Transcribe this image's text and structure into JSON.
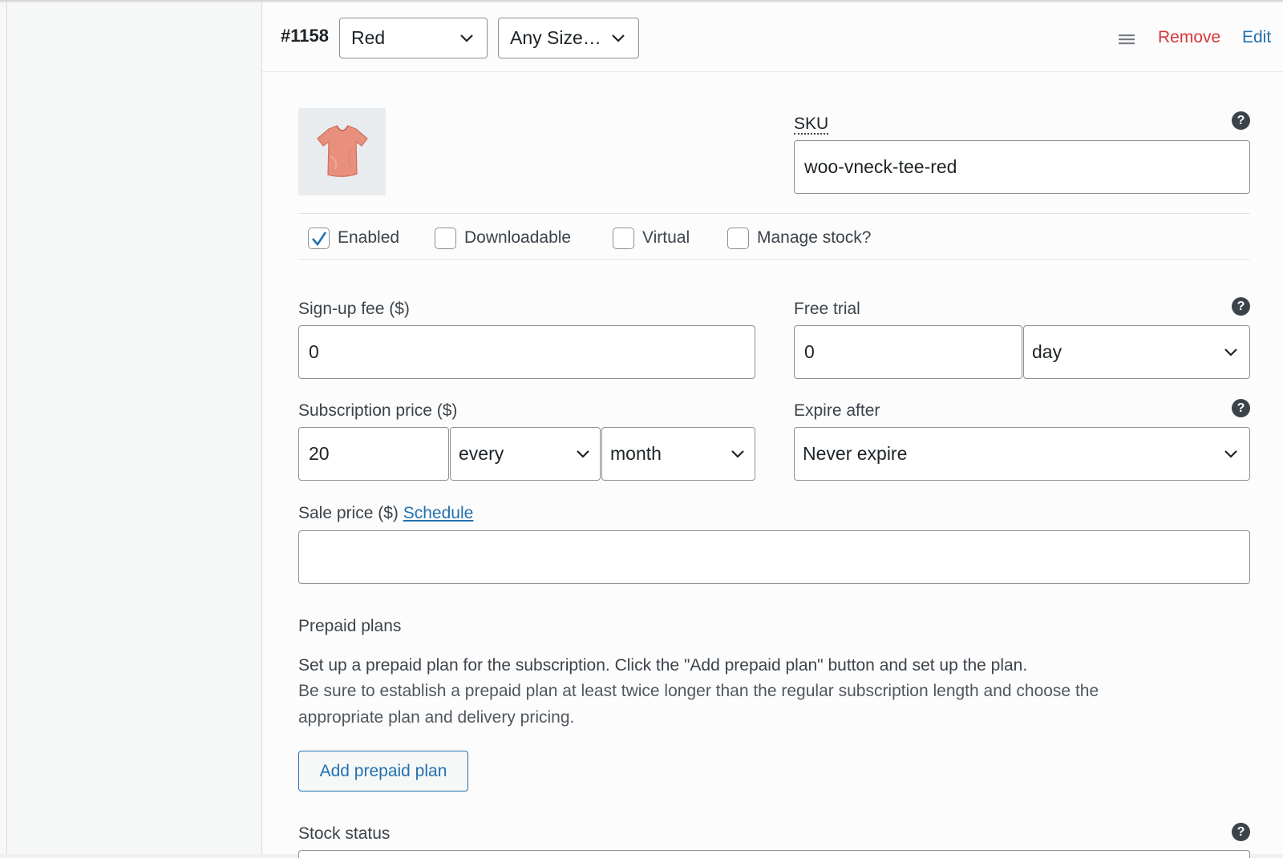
{
  "variation": {
    "id": "#1158",
    "attribute_color": "Red",
    "attribute_size": "Any Size…",
    "remove_label": "Remove",
    "edit_label": "Edit"
  },
  "sku": {
    "label": "SKU",
    "value": "woo-vneck-tee-red"
  },
  "options": {
    "enabled": {
      "label": "Enabled",
      "checked": true
    },
    "downloadable": {
      "label": "Downloadable",
      "checked": false
    },
    "virtual": {
      "label": "Virtual",
      "checked": false
    },
    "manage_stock": {
      "label": "Manage stock?",
      "checked": false
    }
  },
  "signup_fee": {
    "label": "Sign-up fee ($)",
    "value": "0"
  },
  "free_trial": {
    "label": "Free trial",
    "value": "0",
    "period": "day"
  },
  "subscription_price": {
    "label": "Subscription price ($)",
    "value": "20",
    "interval": "every",
    "period": "month"
  },
  "expire_after": {
    "label": "Expire after",
    "value": "Never expire"
  },
  "sale_price": {
    "label": "Sale price ($)",
    "schedule_link": "Schedule",
    "value": ""
  },
  "prepaid": {
    "heading": "Prepaid plans",
    "line1": "Set up a prepaid plan for the subscription. Click the \"Add prepaid plan\" button and set up the plan.",
    "line2": "Be sure to establish a prepaid plan at least twice longer than the regular subscription length and choose the",
    "line3": "appropriate plan and delivery pricing.",
    "button_label": "Add prepaid plan"
  },
  "stock_status": {
    "label": "Stock status"
  },
  "colors": {
    "link": "#2271b1",
    "remove": "#d63638",
    "checkbox_tick": "#2271b1"
  },
  "icons": {
    "help": "help-icon",
    "drag": "drag-handle-icon",
    "chevron": "chevron-down-icon",
    "product": "tshirt-thumbnail"
  }
}
